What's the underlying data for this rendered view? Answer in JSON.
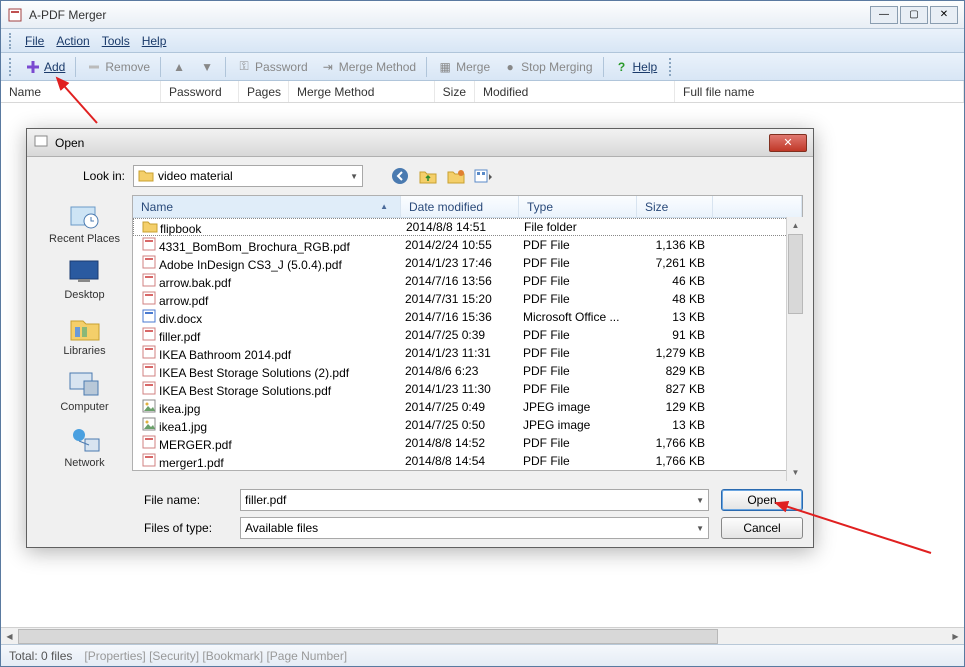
{
  "window": {
    "title": "A-PDF Merger"
  },
  "menus": {
    "file": "File",
    "action": "Action",
    "tools": "Tools",
    "help": "Help"
  },
  "toolbar": {
    "add": "Add",
    "remove": "Remove",
    "password": "Password",
    "merge_method": "Merge Method",
    "merge": "Merge",
    "stop_merging": "Stop Merging",
    "help": "Help"
  },
  "columns": {
    "name": "Name",
    "password": "Password",
    "pages": "Pages",
    "merge_method": "Merge Method",
    "size": "Size",
    "modified": "Modified",
    "full_file_name": "Full file name"
  },
  "status": {
    "total": "Total: 0 files",
    "tabs": "[Properties] [Security] [Bookmark] [Page Number]"
  },
  "dialog": {
    "title": "Open",
    "look_in_label": "Look in:",
    "look_in_value": "video material",
    "file_name_label": "File name:",
    "file_name_value": "filler.pdf",
    "files_of_type_label": "Files of type:",
    "files_of_type_value": "Available files",
    "open_btn": "Open",
    "cancel_btn": "Cancel",
    "headers": {
      "name": "Name",
      "date_modified": "Date modified",
      "type": "Type",
      "size": "Size"
    },
    "places": {
      "recent": "Recent Places",
      "desktop": "Desktop",
      "libraries": "Libraries",
      "computer": "Computer",
      "network": "Network"
    },
    "files": [
      {
        "icon": "folder",
        "name": "flipbook",
        "date": "2014/8/8 14:51",
        "type": "File folder",
        "size": ""
      },
      {
        "icon": "pdf",
        "name": "4331_BomBom_Brochura_RGB.pdf",
        "date": "2014/2/24 10:55",
        "type": "PDF File",
        "size": "1,136 KB"
      },
      {
        "icon": "pdf",
        "name": "Adobe InDesign CS3_J (5.0.4).pdf",
        "date": "2014/1/23 17:46",
        "type": "PDF File",
        "size": "7,261 KB"
      },
      {
        "icon": "pdf",
        "name": "arrow.bak.pdf",
        "date": "2014/7/16 13:56",
        "type": "PDF File",
        "size": "46 KB"
      },
      {
        "icon": "pdf",
        "name": "arrow.pdf",
        "date": "2014/7/31 15:20",
        "type": "PDF File",
        "size": "48 KB"
      },
      {
        "icon": "doc",
        "name": "div.docx",
        "date": "2014/7/16 15:36",
        "type": "Microsoft Office ...",
        "size": "13 KB"
      },
      {
        "icon": "pdf",
        "name": "filler.pdf",
        "date": "2014/7/25 0:39",
        "type": "PDF File",
        "size": "91 KB"
      },
      {
        "icon": "pdf",
        "name": "IKEA Bathroom 2014.pdf",
        "date": "2014/1/23 11:31",
        "type": "PDF File",
        "size": "1,279 KB"
      },
      {
        "icon": "pdf",
        "name": "IKEA Best Storage Solutions (2).pdf",
        "date": "2014/8/6 6:23",
        "type": "PDF File",
        "size": "829 KB"
      },
      {
        "icon": "pdf",
        "name": "IKEA Best Storage Solutions.pdf",
        "date": "2014/1/23 11:30",
        "type": "PDF File",
        "size": "827 KB"
      },
      {
        "icon": "img",
        "name": "ikea.jpg",
        "date": "2014/7/25 0:49",
        "type": "JPEG image",
        "size": "129 KB"
      },
      {
        "icon": "img",
        "name": "ikea1.jpg",
        "date": "2014/7/25 0:50",
        "type": "JPEG image",
        "size": "13 KB"
      },
      {
        "icon": "pdf",
        "name": "MERGER.pdf",
        "date": "2014/8/8 14:52",
        "type": "PDF File",
        "size": "1,766 KB"
      },
      {
        "icon": "pdf",
        "name": "merger1.pdf",
        "date": "2014/8/8 14:54",
        "type": "PDF File",
        "size": "1,766 KB"
      }
    ]
  }
}
